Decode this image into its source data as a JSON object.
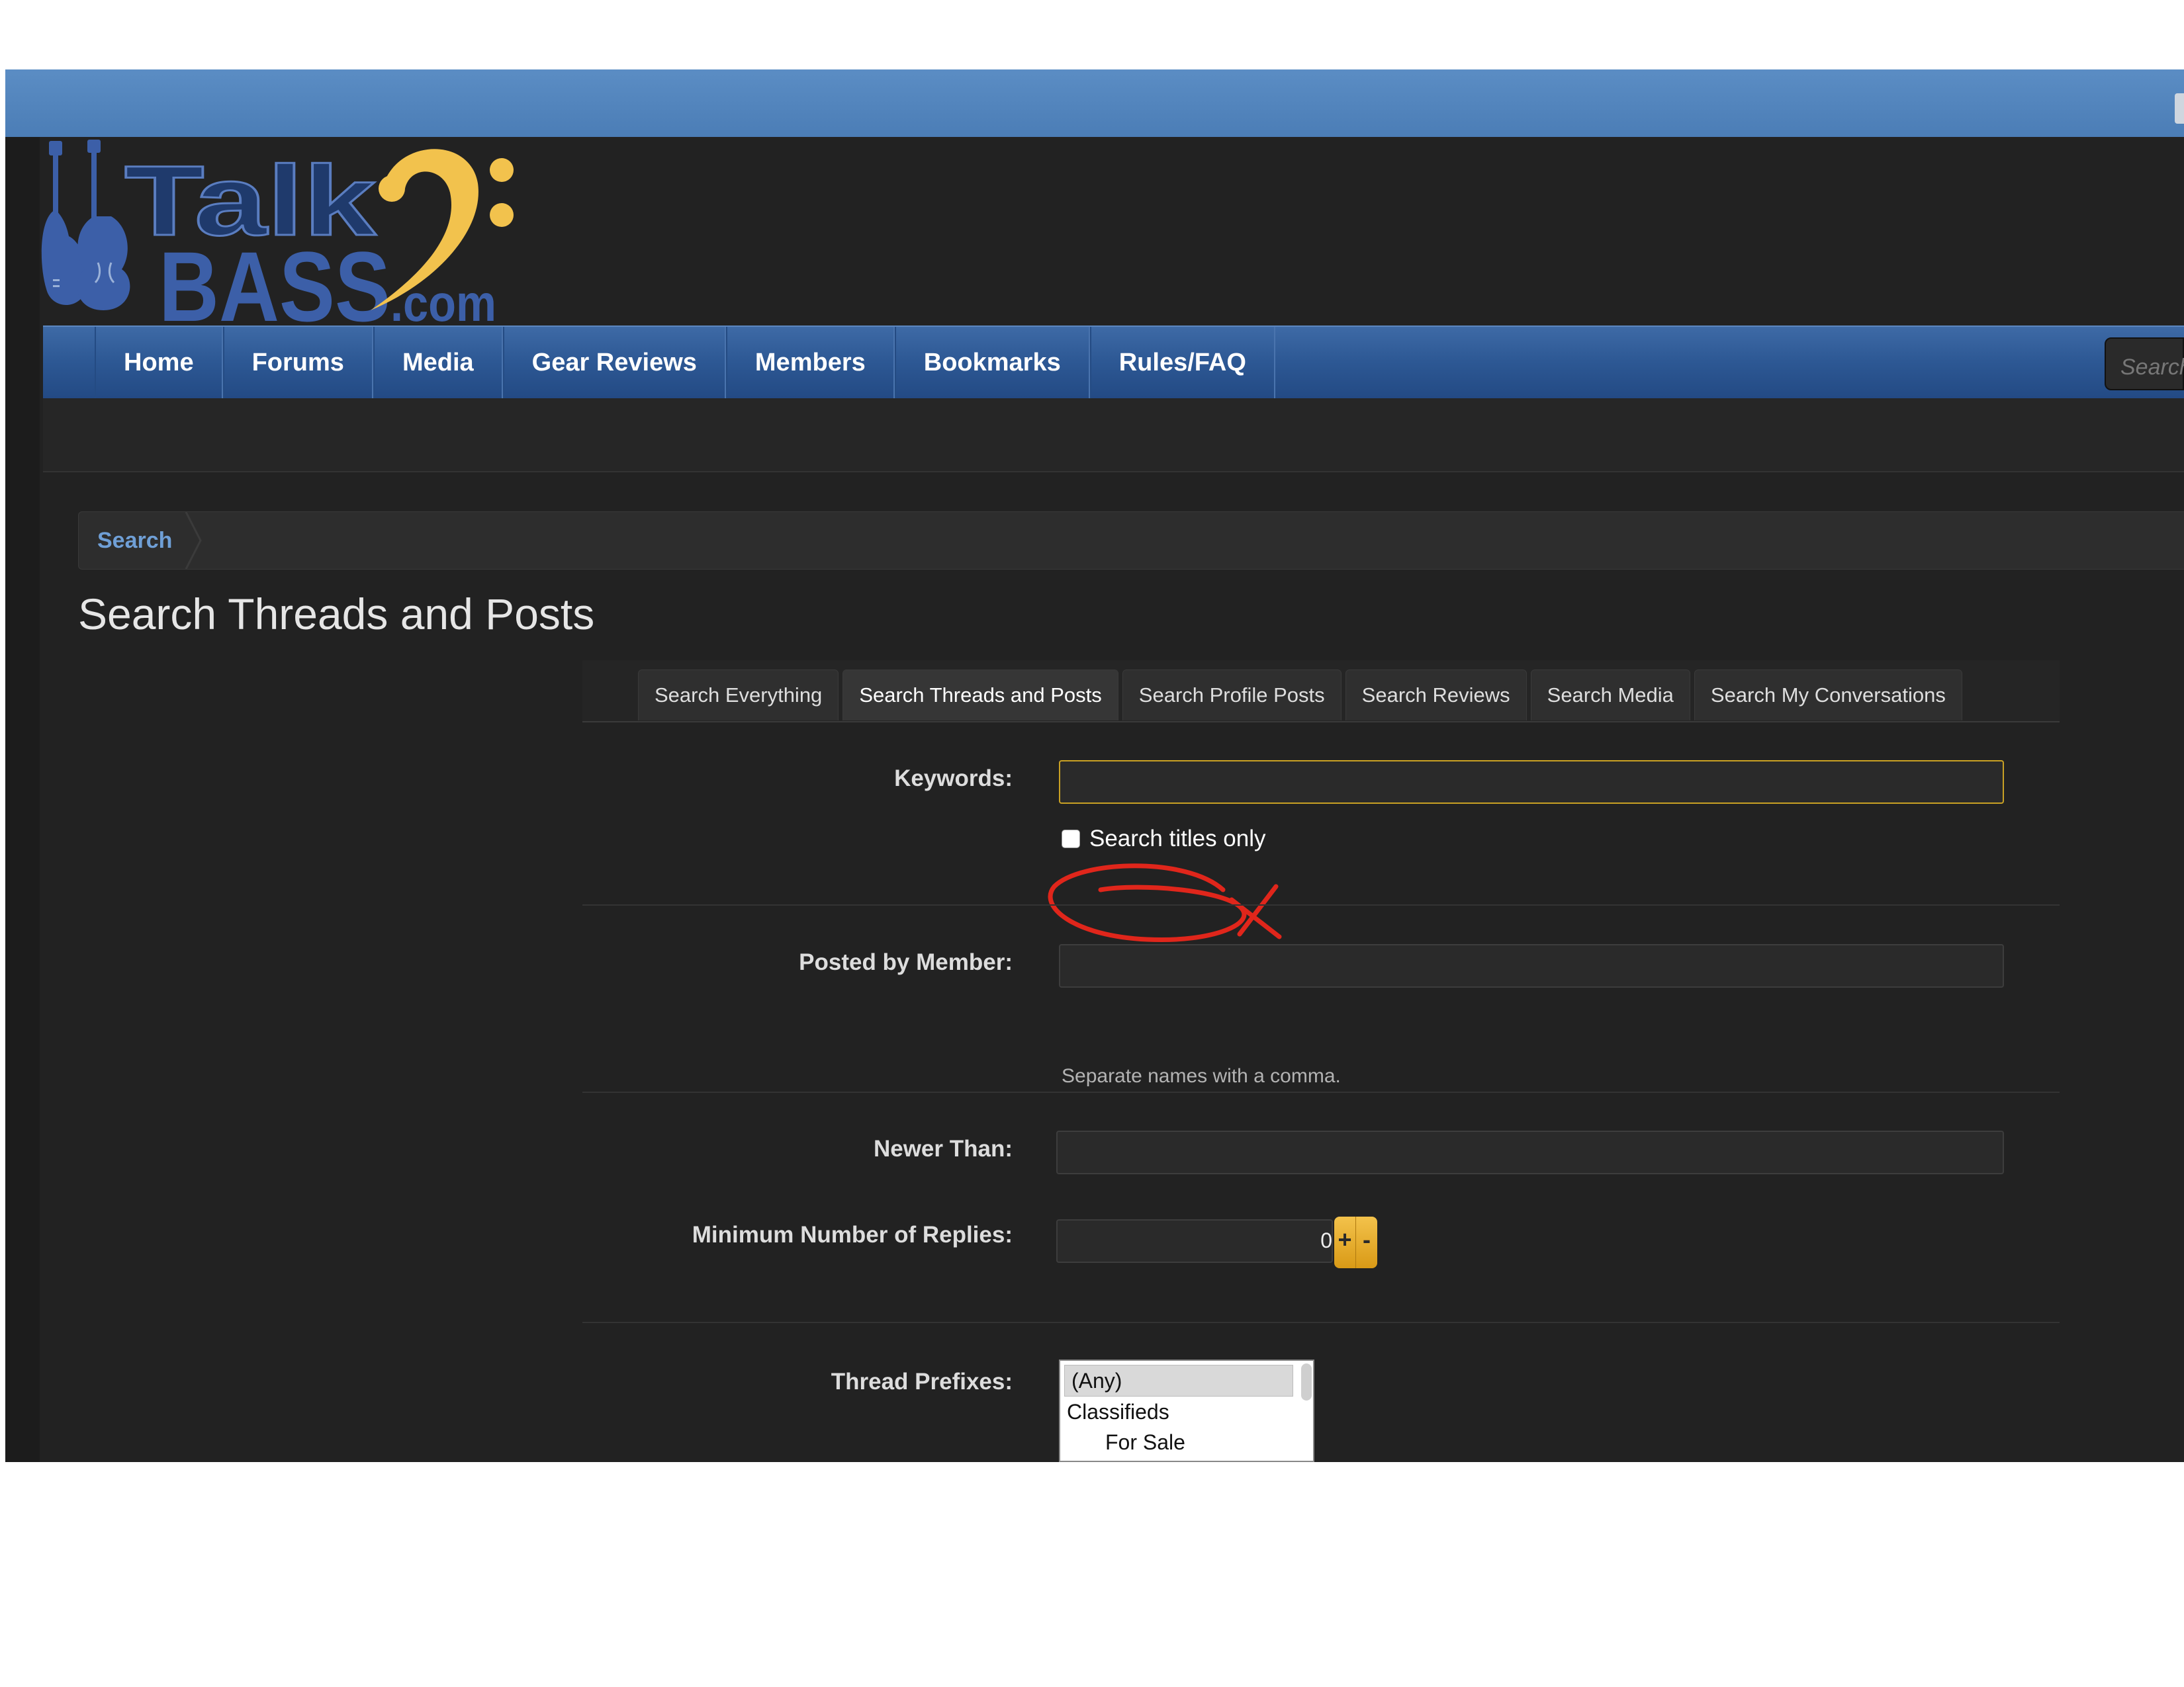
{
  "logo": {
    "text_talk": "Talk",
    "text_bass": "BASS",
    "text_com": ".com"
  },
  "nav": {
    "items": [
      {
        "label": "Home"
      },
      {
        "label": "Forums"
      },
      {
        "label": "Media"
      },
      {
        "label": "Gear Reviews"
      },
      {
        "label": "Members"
      },
      {
        "label": "Bookmarks"
      },
      {
        "label": "Rules/FAQ"
      }
    ],
    "search_placeholder": "Search"
  },
  "breadcrumb": {
    "current": "Search"
  },
  "page_title": "Search Threads and Posts",
  "tabs": [
    {
      "label": "Search Everything"
    },
    {
      "label": "Search Threads and Posts",
      "active": true
    },
    {
      "label": "Search Profile Posts"
    },
    {
      "label": "Search Reviews"
    },
    {
      "label": "Search Media"
    },
    {
      "label": "Search My Conversations"
    }
  ],
  "form": {
    "keywords_label": "Keywords:",
    "keywords_value": "",
    "titles_only_label": "Search titles only",
    "posted_by_label": "Posted by Member:",
    "posted_by_value": "",
    "posted_by_hint": "Separate names with a comma.",
    "newer_than_label": "Newer Than:",
    "newer_than_value": "",
    "min_replies_label": "Minimum Number of Replies:",
    "min_replies_value": "0",
    "plus_label": "+",
    "minus_label": "-",
    "thread_prefixes_label": "Thread Prefixes:",
    "thread_prefixes": [
      "(Any)",
      "Classifieds",
      "For Sale"
    ]
  },
  "colors": {
    "topbar": "#4f82bd",
    "nav_blue": "#2d5894",
    "accent_gold": "#e8b03a",
    "annotation_red": "#e0261b",
    "link_blue": "#6f9fd6"
  }
}
